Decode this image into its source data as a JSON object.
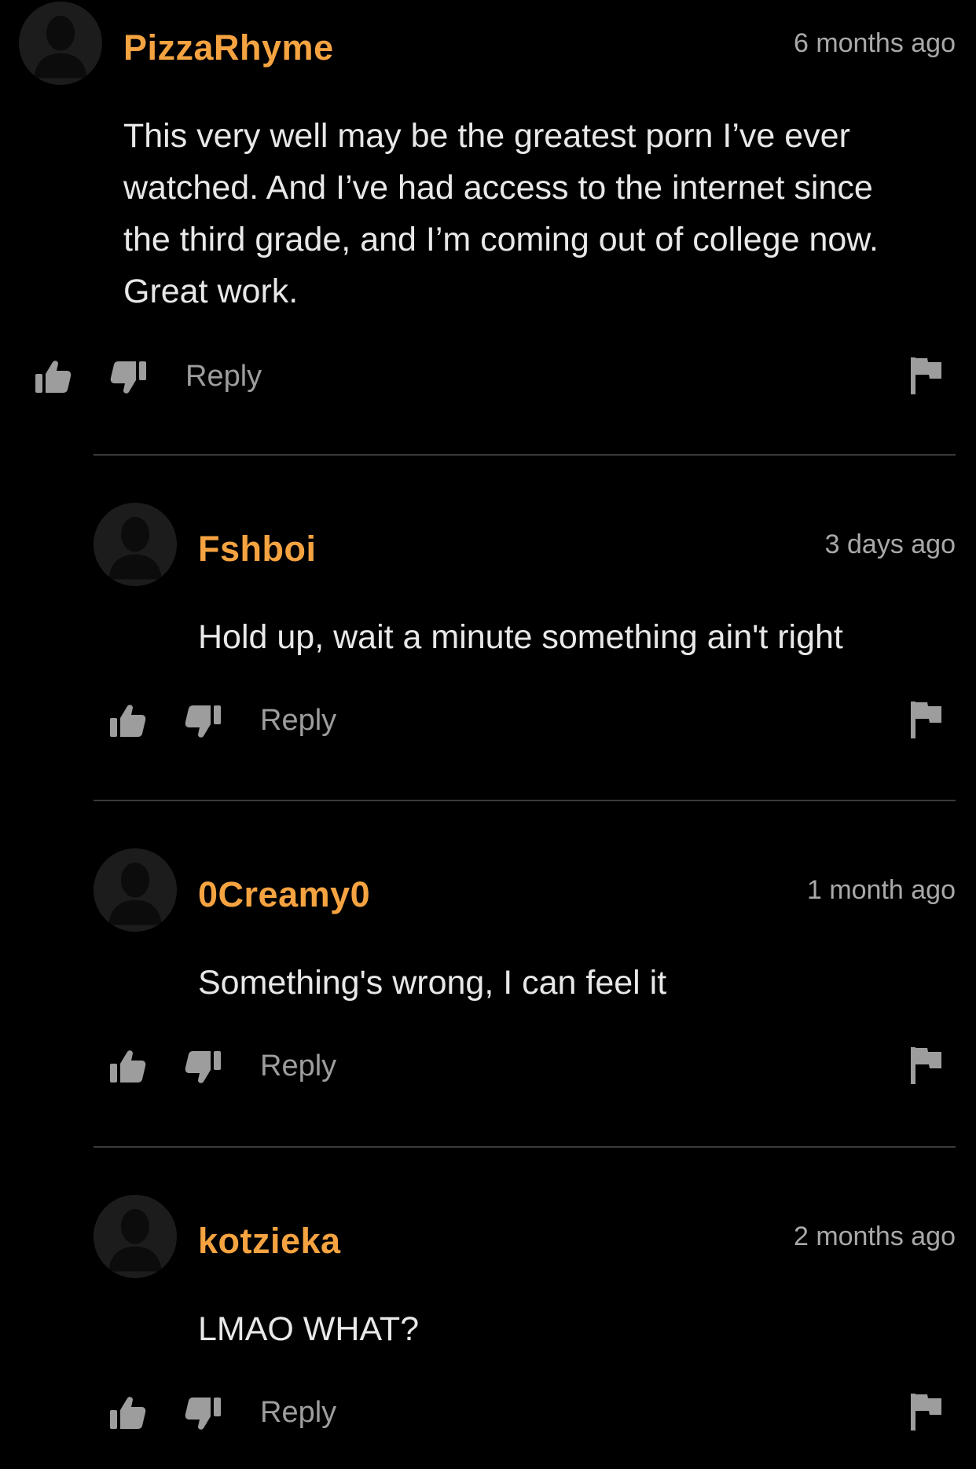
{
  "colors": {
    "background": "#000000",
    "username": "#f5a341",
    "timestamp": "#a9a9a9",
    "body_text": "#e8e8e8",
    "action_icons": "#9d9d9d",
    "divider": "#3a3a3a",
    "avatar_bg": "#1c1c1c"
  },
  "icons": {
    "avatar": "default-user-silhouette-icon",
    "like": "thumbs-up-icon",
    "dislike": "thumbs-down-icon",
    "flag": "flag-icon"
  },
  "comments": [
    {
      "username": "PizzaRhyme",
      "timestamp": "6 months ago",
      "body": "This very well may be the greatest porn I’ve ever watched. And I’ve had access to the internet since the third grade, and I’m coming out of college now. Great work.",
      "reply_label": "Reply"
    },
    {
      "username": "Fshboi",
      "timestamp": "3 days ago",
      "body": "Hold up, wait a minute something ain't right",
      "reply_label": "Reply"
    },
    {
      "username": "0Creamy0",
      "timestamp": "1 month ago",
      "body": "Something's wrong, I can feel it",
      "reply_label": "Reply"
    },
    {
      "username": "kotzieka",
      "timestamp": "2 months ago",
      "body": "LMAO WHAT?",
      "reply_label": "Reply"
    }
  ]
}
